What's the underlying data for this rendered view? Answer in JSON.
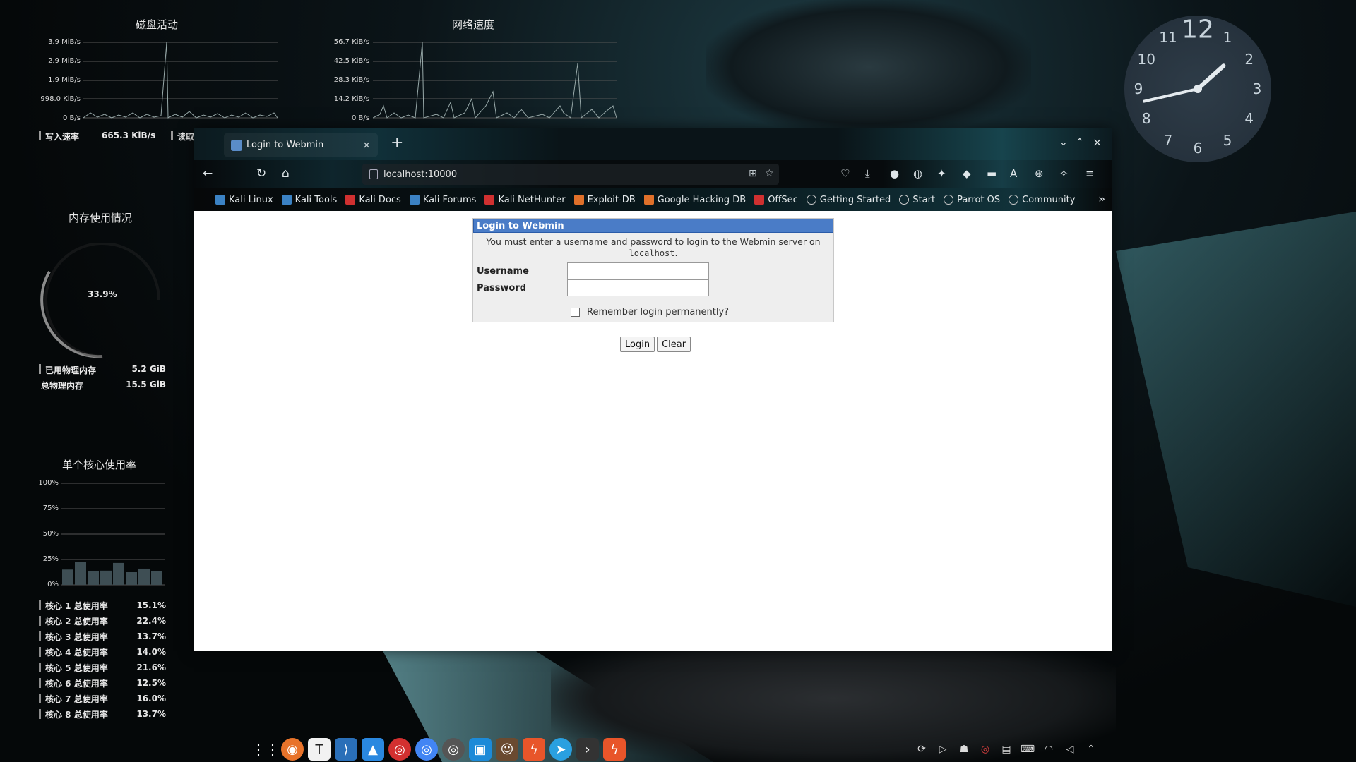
{
  "desktop": {
    "disk_widget": {
      "title": "磁盘活动",
      "y_labels": [
        "3.9 MiB/s",
        "2.9 MiB/s",
        "1.9 MiB/s",
        "998.0 KiB/s",
        "0 B/s"
      ],
      "write_label": "写入速率",
      "write_value": "665.3 KiB/s",
      "read_label": "读取速"
    },
    "net_widget": {
      "title": "网络速度",
      "y_labels": [
        "56.7 KiB/s",
        "42.5 KiB/s",
        "28.3 KiB/s",
        "14.2 KiB/s",
        "0 B/s"
      ]
    },
    "memory_widget": {
      "title": "内存使用情况",
      "percent": "33.9%",
      "percent_value": 0.339,
      "used_label": "已用物理内存",
      "used_value": "5.2 GiB",
      "total_label": "总物理内存",
      "total_value": "15.5 GiB"
    },
    "cpu_widget": {
      "title": "单个核心使用率",
      "y_labels": [
        "100%",
        "75%",
        "50%",
        "25%",
        "0%"
      ],
      "cores": [
        {
          "label": "核心 1 总使用率",
          "value": "15.1%"
        },
        {
          "label": "核心 2 总使用率",
          "value": "22.4%"
        },
        {
          "label": "核心 3 总使用率",
          "value": "13.7%"
        },
        {
          "label": "核心 4 总使用率",
          "value": "14.0%"
        },
        {
          "label": "核心 5 总使用率",
          "value": "21.6%"
        },
        {
          "label": "核心 6 总使用率",
          "value": "12.5%"
        },
        {
          "label": "核心 7 总使用率",
          "value": "16.0%"
        },
        {
          "label": "核心 8 总使用率",
          "value": "13.7%"
        }
      ],
      "bar_values": [
        15.1,
        22.4,
        13.7,
        14.0,
        21.6,
        12.5,
        16.0,
        13.7
      ]
    },
    "clock": {
      "numbers": [
        "12",
        "1",
        "2",
        "3",
        "4",
        "5",
        "6",
        "7",
        "8",
        "9",
        "10",
        "11"
      ]
    }
  },
  "browser": {
    "tab": {
      "label": "Login to Webmin",
      "close": "×"
    },
    "new_tab": "+",
    "window_controls": {
      "minimize": "⌄",
      "maximize": "⌃",
      "close": "×"
    },
    "url": "localhost:10000",
    "bookmarks": [
      {
        "label": "Kali Linux",
        "color": "#3b82c4"
      },
      {
        "label": "Kali Tools",
        "color": "#3b82c4"
      },
      {
        "label": "Kali Docs",
        "color": "#d03030"
      },
      {
        "label": "Kali Forums",
        "color": "#3b82c4"
      },
      {
        "label": "Kali NetHunter",
        "color": "#d03030"
      },
      {
        "label": "Exploit-DB",
        "color": "#e0702a"
      },
      {
        "label": "Google Hacking DB",
        "color": "#e0702a"
      },
      {
        "label": "OffSec",
        "color": "#d03030"
      },
      {
        "label": "Getting Started",
        "color": "#cccccc"
      },
      {
        "label": "Start",
        "color": "#cccccc"
      },
      {
        "label": "Parrot OS",
        "color": "#cccccc"
      },
      {
        "label": "Community",
        "color": "#cccccc"
      }
    ],
    "more": "»"
  },
  "login": {
    "heading": "Login to Webmin",
    "message_pre": "You must enter a username and password to login to the Webmin server on ",
    "message_host": "localhost",
    "message_post": ".",
    "username_label": "Username",
    "password_label": "Password",
    "username_value": "",
    "password_value": "",
    "remember_label": "Remember login permanently?",
    "login_button": "Login",
    "clear_button": "Clear"
  },
  "colors": {
    "webmin_header": "#4a7cc7"
  }
}
